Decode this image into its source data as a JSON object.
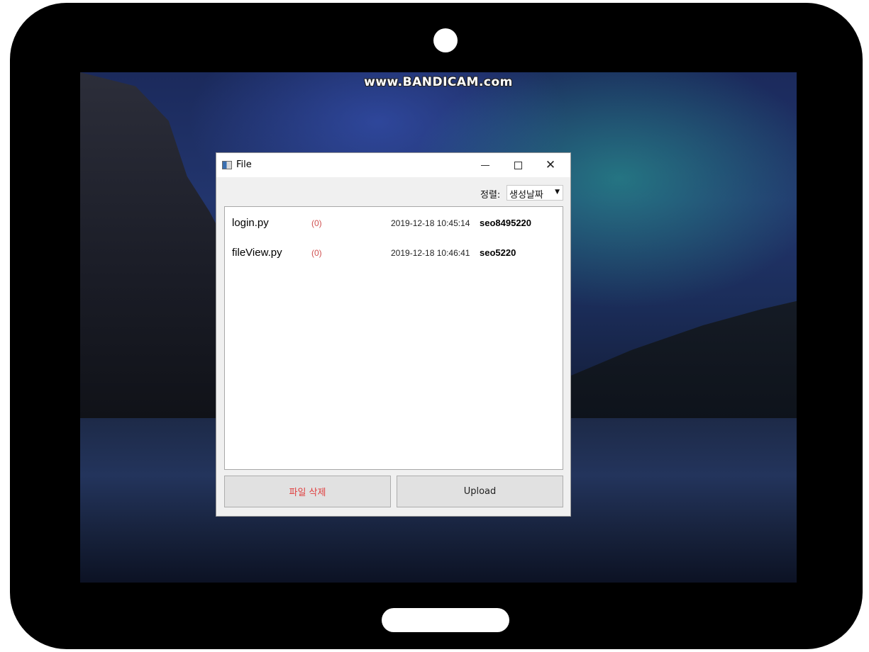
{
  "watermark": "www.BANDICAM.com",
  "window": {
    "title": "File",
    "icon": "window-app-icon",
    "controls": {
      "minimize_icon": "minimize-icon",
      "maximize_icon": "maximize-icon",
      "close_icon": "close-icon",
      "close_glyph": "✕"
    }
  },
  "sort": {
    "label": "정렬:",
    "selected": "생성날짜",
    "arrow": "▼"
  },
  "files": [
    {
      "name": "login.py",
      "count": "(0)",
      "date": "2019-12-18 10:45:14",
      "user": "seo8495220"
    },
    {
      "name": "fileView.py",
      "count": "(0)",
      "date": "2019-12-18 10:46:41",
      "user": "seo5220"
    }
  ],
  "buttons": {
    "delete_label": "파일 삭제",
    "upload_label": "Upload"
  },
  "colors": {
    "delete_text": "#e04040",
    "count_text": "#d05050"
  }
}
